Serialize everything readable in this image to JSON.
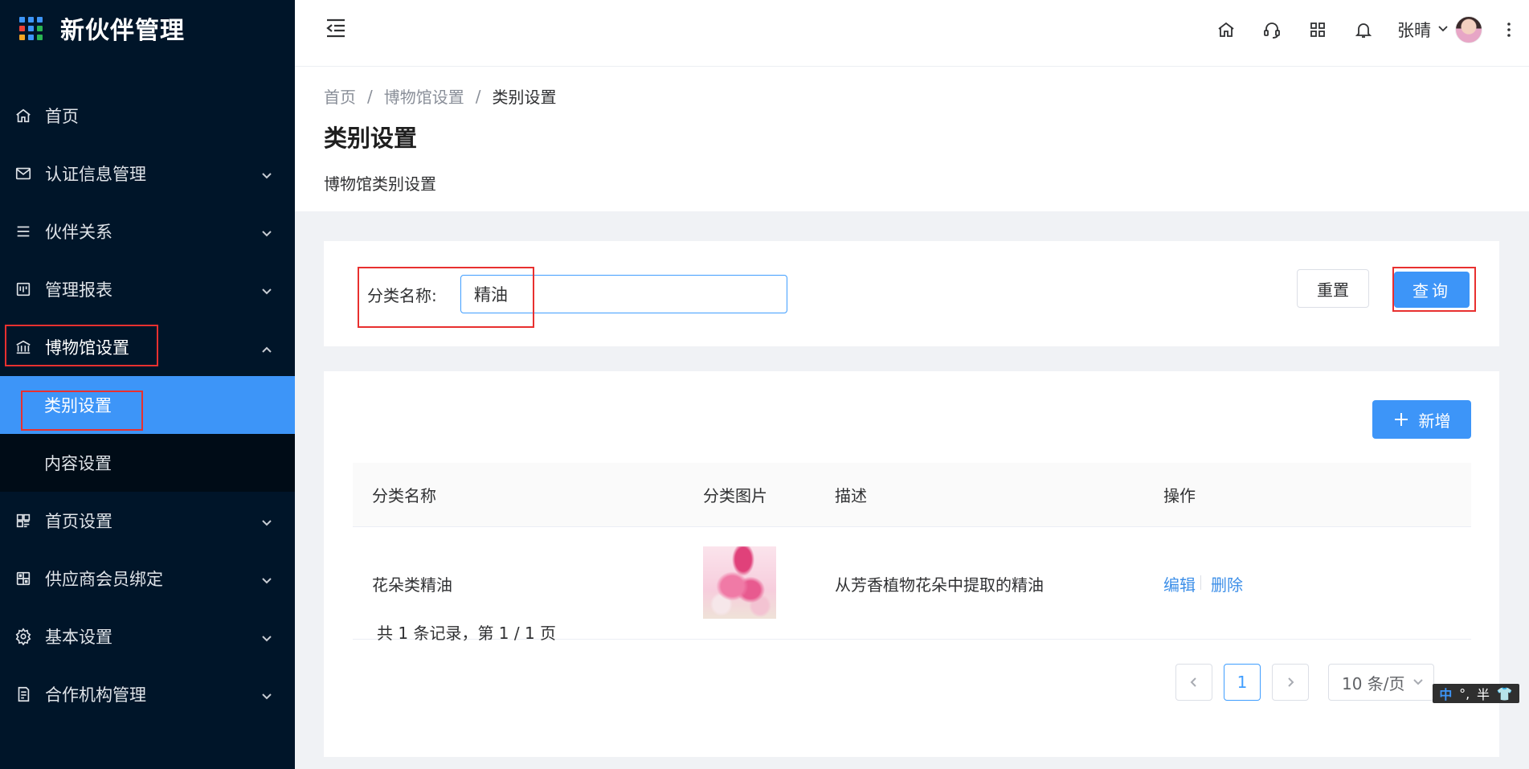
{
  "brand": {
    "title": "新伙伴管理",
    "dot_colors": [
      "#3d95f8",
      "#3d95f8",
      "#3d95f8",
      "#ef4136",
      "#3d95f8",
      "#2ab553",
      "#f5a623",
      "#3d95f8",
      "#2ab553"
    ]
  },
  "sidebar": {
    "items": [
      {
        "label": "首页",
        "icon": "home-icon"
      },
      {
        "label": "认证信息管理",
        "icon": "mail-icon"
      },
      {
        "label": "伙伴关系",
        "icon": "list-icon"
      },
      {
        "label": "管理报表",
        "icon": "board-icon"
      },
      {
        "label": "博物馆设置",
        "icon": "museum-icon"
      },
      {
        "label": "首页设置",
        "icon": "layout-icon"
      },
      {
        "label": "供应商会员绑定",
        "icon": "bind-icon"
      },
      {
        "label": "基本设置",
        "icon": "gear-icon"
      },
      {
        "label": "合作机构管理",
        "icon": "doc-icon"
      }
    ],
    "museum_sub": [
      {
        "label": "类别设置"
      },
      {
        "label": "内容设置"
      }
    ]
  },
  "header": {
    "user_name": "张晴"
  },
  "breadcrumb": {
    "home": "首页",
    "parent": "博物馆设置",
    "current": "类别设置"
  },
  "page": {
    "title": "类别设置",
    "description": "博物馆类别设置"
  },
  "search": {
    "label": "分类名称:",
    "value": "精油",
    "reset_label": "重置",
    "query_label": "查询"
  },
  "table": {
    "add_label": "新增",
    "columns": [
      "分类名称",
      "分类图片",
      "描述",
      "操作"
    ],
    "rows": [
      {
        "name": "花朵类精油",
        "description": "从芳香植物花朵中提取的精油",
        "edit": "编辑",
        "delete": "删除"
      }
    ]
  },
  "pagination": {
    "total_text": "共 1 条记录，第 1 / 1 页",
    "current_page": "1",
    "page_size": "10 条/页"
  },
  "ime": {
    "lang": "中",
    "punct": "°,",
    "width": "半"
  },
  "colors": {
    "sidebar_bg": "#001529",
    "accent": "#3d95f8",
    "highlight_border": "#e8302f"
  }
}
